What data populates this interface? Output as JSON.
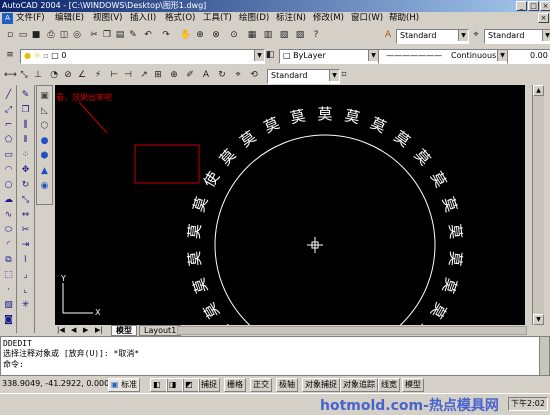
{
  "title_bar": {
    "text": "AutoCAD 2004 - [C:\\WINDOWS\\Desktop\\图形1.dwg]",
    "min": "_",
    "max": "□",
    "close": "×"
  },
  "menu": {
    "items": [
      "文件(F)",
      "编辑(E)",
      "视图(V)",
      "插入(I)",
      "格式(O)",
      "工具(T)",
      "绘图(D)",
      "标注(N)",
      "修改(M)",
      "窗口(W)",
      "帮助(H)"
    ],
    "doc_close": "×"
  },
  "toolbar": {
    "text_style": "Standard",
    "dim_style": "Standard",
    "layer_value": "0",
    "color_value": "ByLayer",
    "linetype_value": "Continuous",
    "lineweight_partial": "0.00",
    "table_style": "Standard"
  },
  "canvas": {
    "annotation": "看，效果出来吧",
    "ring_character": "莫",
    "ring_highlight_character": "使",
    "bg_color": "#000000",
    "geometry_color": "#ffffff",
    "annotation_color": "#cc0000"
  },
  "tabs": {
    "model": "模型",
    "layout1": "Layout1"
  },
  "command_line": {
    "line1": "DDEDIT",
    "line2": "选择注释对象或 [放弃(U)]:   *取消*",
    "line3": "命令:"
  },
  "status_bar": {
    "coords": "338.9049, -41.2922, 0.0000",
    "ucs_label": "标准",
    "buttons": [
      "捕捉",
      "栅格",
      "正交",
      "极轴",
      "对象捕捉",
      "对象追踪",
      "线宽",
      "模型"
    ]
  },
  "taskbar": {
    "clock": "下午2:02",
    "watermark": "hotmold.com-热点模具网"
  }
}
